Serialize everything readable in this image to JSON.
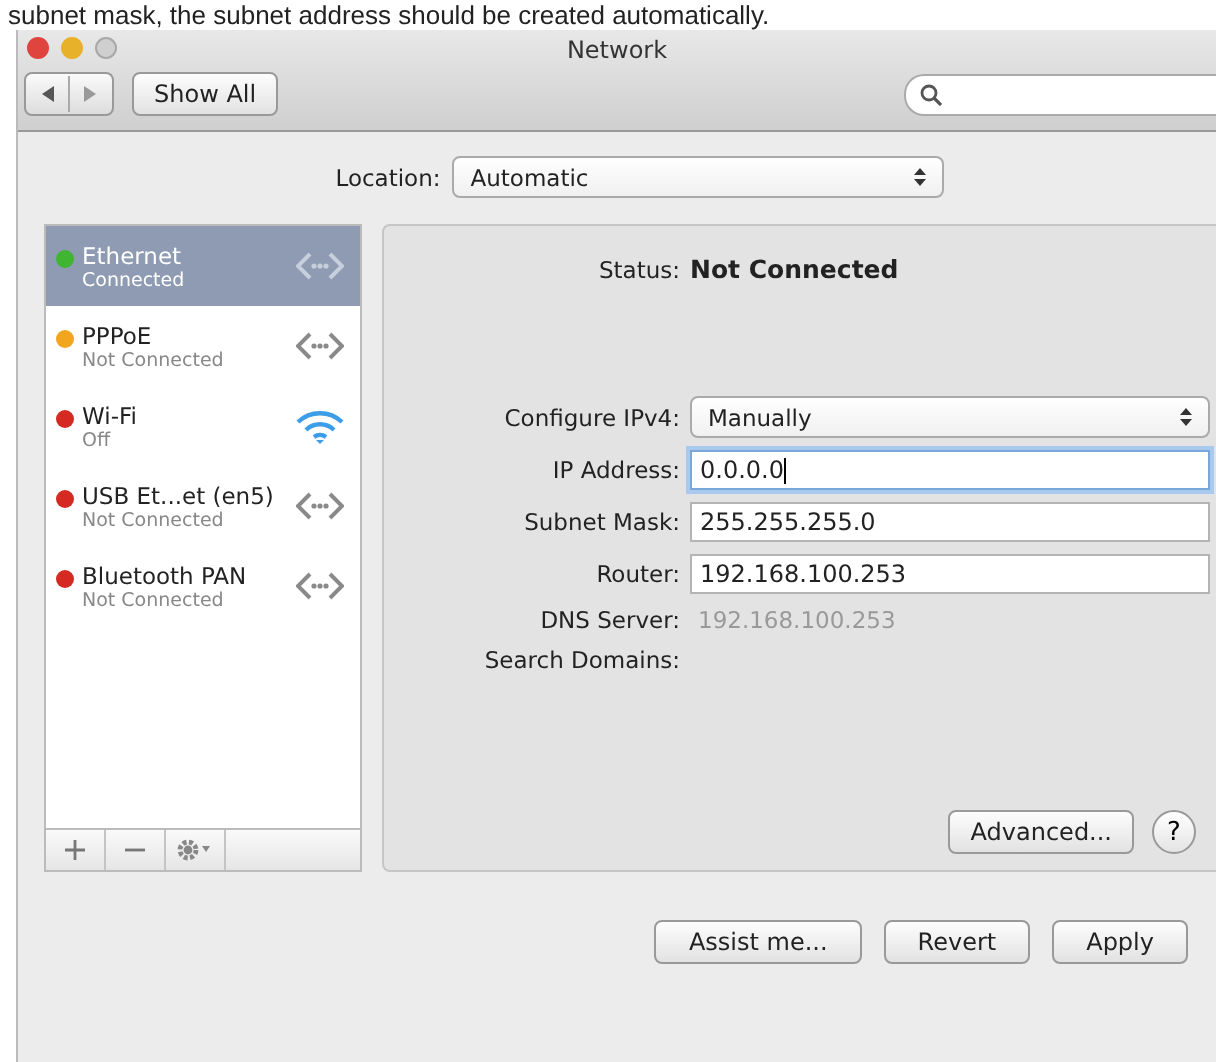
{
  "caption": "subnet mask, the subnet address should be created automatically.",
  "window": {
    "title": "Network"
  },
  "toolbar": {
    "show_all": "Show All"
  },
  "location": {
    "label": "Location:",
    "value": "Automatic"
  },
  "services": [
    {
      "name": "Ethernet",
      "status": "Connected",
      "color": "#3fb531",
      "kind": "wired",
      "selected": true
    },
    {
      "name": "PPPoE",
      "status": "Not Connected",
      "color": "#f2a51e",
      "kind": "wired",
      "selected": false
    },
    {
      "name": "Wi-Fi",
      "status": "Off",
      "color": "#d42a22",
      "kind": "wifi",
      "selected": false
    },
    {
      "name": "USB Et...et (en5)",
      "status": "Not Connected",
      "color": "#d42a22",
      "kind": "wired",
      "selected": false
    },
    {
      "name": "Bluetooth PAN",
      "status": "Not Connected",
      "color": "#d42a22",
      "kind": "wired",
      "selected": false
    }
  ],
  "status": {
    "label": "Status:",
    "value": "Not Connected"
  },
  "form": [
    {
      "kind": "select",
      "label": "Configure IPv4:",
      "value": "Manually"
    },
    {
      "kind": "input",
      "label": "IP Address:",
      "value": "0.0.0.0",
      "focused": true
    },
    {
      "kind": "input",
      "label": "Subnet Mask:",
      "value": "255.255.255.0",
      "focused": false
    },
    {
      "kind": "input",
      "label": "Router:",
      "value": "192.168.100.253",
      "focused": false
    },
    {
      "kind": "text",
      "label": "DNS Server:",
      "value": "192.168.100.253"
    },
    {
      "kind": "label",
      "label": "Search Domains:"
    }
  ],
  "panel_buttons": {
    "advanced": "Advanced...",
    "help": "?"
  },
  "buttons": [
    "Assist me...",
    "Revert",
    "Apply"
  ]
}
